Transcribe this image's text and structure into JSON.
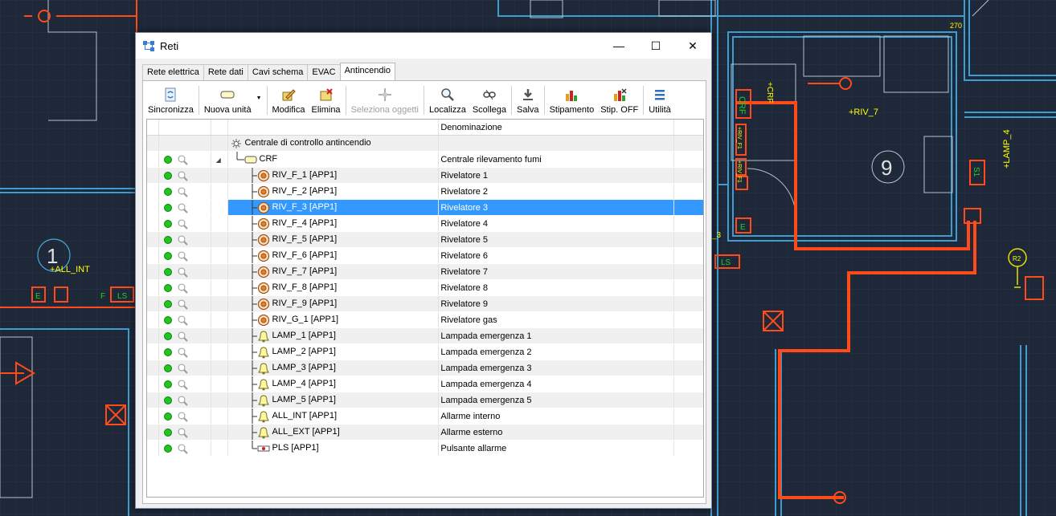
{
  "window": {
    "title": "Reti"
  },
  "window_buttons": {
    "minimize": "—",
    "maximize": "☐",
    "close": "✕"
  },
  "tabs": [
    {
      "label": "Rete elettrica"
    },
    {
      "label": "Rete dati"
    },
    {
      "label": "Cavi schema"
    },
    {
      "label": "EVAC"
    },
    {
      "label": "Antincendio",
      "active": true
    }
  ],
  "toolbar": [
    {
      "label": "Sincronizza",
      "icon": "sync-icon"
    },
    {
      "label": "Nuova unità",
      "icon": "unit-icon",
      "dropdown": true
    },
    {
      "label": "Modifica",
      "icon": "edit-icon"
    },
    {
      "label": "Elimina",
      "icon": "delete-icon"
    },
    {
      "label": "Seleziona oggetti",
      "icon": "select-icon",
      "disabled": true
    },
    {
      "label": "Localizza",
      "icon": "search-icon"
    },
    {
      "label": "Scollega",
      "icon": "unlink-icon"
    },
    {
      "label": "Salva",
      "icon": "save-icon"
    },
    {
      "label": "Stipamento",
      "icon": "fill-chart-icon"
    },
    {
      "label": "Stip. OFF",
      "icon": "fill-off-icon"
    },
    {
      "label": "Utilità",
      "icon": "menu-icon"
    }
  ],
  "grid": {
    "header": {
      "denominazione": "Denominazione"
    },
    "selected_row": 3,
    "rows": [
      {
        "name": "Centrale di controllo antincendio",
        "desc": "",
        "icon": "central-icon",
        "level": 0,
        "status": false
      },
      {
        "name": "CRF",
        "desc": "Centrale rilevamento fumi",
        "icon": "panel-icon",
        "level": 1,
        "status": true,
        "expanded": true
      },
      {
        "name": "RIV_F_1 [APP1]",
        "desc": "Rivelatore 1",
        "icon": "detector-icon",
        "level": 2,
        "status": true
      },
      {
        "name": "RIV_F_2 [APP1]",
        "desc": "Rivelatore 2",
        "icon": "detector-icon",
        "level": 2,
        "status": true
      },
      {
        "name": "RIV_F_3 [APP1]",
        "desc": "Rivelatore 3",
        "icon": "detector-icon",
        "level": 2,
        "status": true
      },
      {
        "name": "RIV_F_4 [APP1]",
        "desc": "Rivelatore 4",
        "icon": "detector-icon",
        "level": 2,
        "status": true
      },
      {
        "name": "RIV_F_5 [APP1]",
        "desc": "Rivelatore 5",
        "icon": "detector-icon",
        "level": 2,
        "status": true
      },
      {
        "name": "RIV_F_6 [APP1]",
        "desc": "Rivelatore 6",
        "icon": "detector-icon",
        "level": 2,
        "status": true
      },
      {
        "name": "RIV_F_7 [APP1]",
        "desc": "Rivelatore 7",
        "icon": "detector-icon",
        "level": 2,
        "status": true
      },
      {
        "name": "RIV_F_8 [APP1]",
        "desc": "Rivelatore 8",
        "icon": "detector-icon",
        "level": 2,
        "status": true
      },
      {
        "name": "RIV_F_9 [APP1]",
        "desc": "Rivelatore 9",
        "icon": "detector-icon",
        "level": 2,
        "status": true
      },
      {
        "name": "RIV_G_1 [APP1]",
        "desc": "Rivelatore gas",
        "icon": "detector-icon",
        "level": 2,
        "status": true
      },
      {
        "name": "LAMP_1 [APP1]",
        "desc": "Lampada emergenza 1",
        "icon": "bell-icon",
        "level": 2,
        "status": true
      },
      {
        "name": "LAMP_2 [APP1]",
        "desc": "Lampada emergenza 2",
        "icon": "bell-icon",
        "level": 2,
        "status": true
      },
      {
        "name": "LAMP_3 [APP1]",
        "desc": "Lampada emergenza 3",
        "icon": "bell-icon",
        "level": 2,
        "status": true
      },
      {
        "name": "LAMP_4 [APP1]",
        "desc": "Lampada emergenza 4",
        "icon": "bell-icon",
        "level": 2,
        "status": true
      },
      {
        "name": "LAMP_5 [APP1]",
        "desc": "Lampada emergenza 5",
        "icon": "bell-icon",
        "level": 2,
        "status": true
      },
      {
        "name": "ALL_INT [APP1]",
        "desc": "Allarme interno",
        "icon": "bell-icon",
        "level": 2,
        "status": true
      },
      {
        "name": "ALL_EXT [APP1]",
        "desc": "Allarme esterno",
        "icon": "bell-icon",
        "level": 2,
        "status": true
      },
      {
        "name": "PLS [APP1]",
        "desc": "Pulsante allarme",
        "icon": "button-icon",
        "level": 2,
        "status": true,
        "last": true
      }
    ]
  },
  "cad_labels": {
    "room_9": "9",
    "room_1": "1",
    "riv7": "+RIV_7",
    "lamp4": "+LAMP_4",
    "all_int": "+ALL_INT",
    "crf": "CRF",
    "crf_plus": "+CRF",
    "num270": "270",
    "s1": "S1",
    "ls_left": "LS",
    "ls_mid": "LS",
    "e_left": "E",
    "e_mid": "E",
    "f": "F",
    "r2": "R2",
    "riv_f1": "+RIV_F1",
    "riv_f1b": "+RIV_F1",
    "r3": "_3"
  },
  "colors": {
    "selection": "#3399ff",
    "cad_bg": "#1e2838",
    "cad_line": "#4aa8d8",
    "cad_red": "#ff4a1a"
  }
}
